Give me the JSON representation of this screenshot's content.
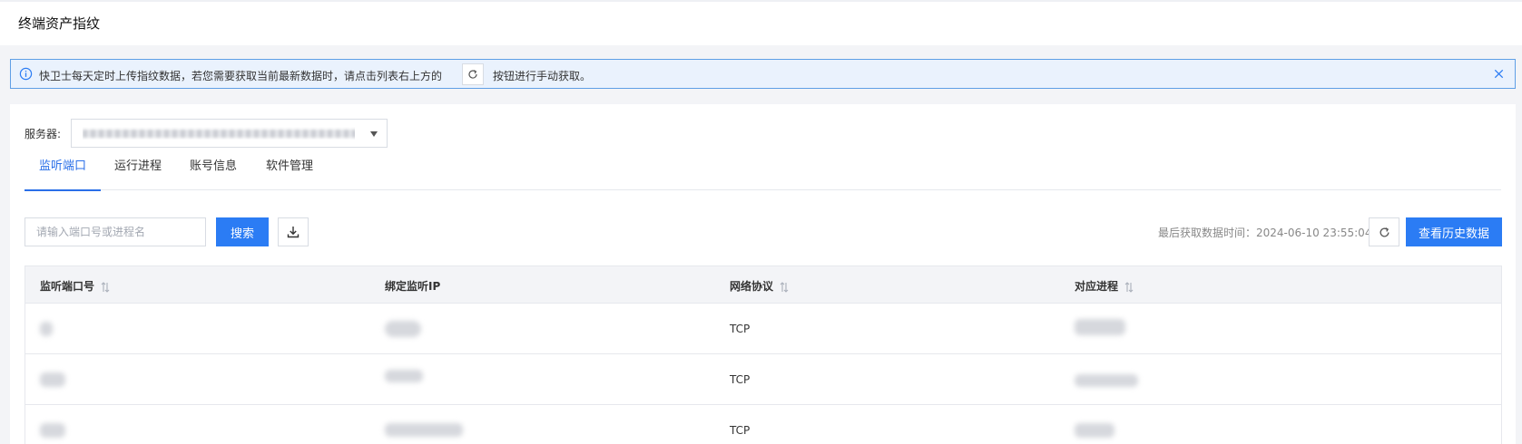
{
  "page": {
    "title": "终端资产指纹"
  },
  "notice": {
    "text_before": "快卫士每天定时上传指纹数据，若您需要获取当前最新数据时，请点击列表右上方的",
    "text_after": "按钮进行手动获取。"
  },
  "filter": {
    "server_label": "服务器:",
    "server_value": ""
  },
  "tabs": [
    {
      "label": "监听端口",
      "active": true
    },
    {
      "label": "运行进程",
      "active": false
    },
    {
      "label": "账号信息",
      "active": false
    },
    {
      "label": "软件管理",
      "active": false
    }
  ],
  "toolbar": {
    "search_placeholder": "请输入端口号或进程名",
    "search_label": "搜索",
    "last_fetch_label": "最后获取数据时间：2024-06-10 23:55:04",
    "history_label": "查看历史数据"
  },
  "table": {
    "columns": [
      "监听端口号",
      "绑定监听IP",
      "网络协议",
      "对应进程"
    ],
    "rows": [
      {
        "protocol": "TCP"
      },
      {
        "protocol": "TCP"
      },
      {
        "protocol": "TCP"
      }
    ]
  },
  "colors": {
    "primary": "#2b7cf4",
    "notice_bg": "#eaf2fd",
    "notice_border": "#5f9fe6"
  },
  "icons": {
    "info": "info-circle-icon",
    "refresh": "refresh-icon",
    "close": "close-icon",
    "download": "download-icon",
    "sort": "sort-icon",
    "dropdown": "caret-down-icon"
  }
}
